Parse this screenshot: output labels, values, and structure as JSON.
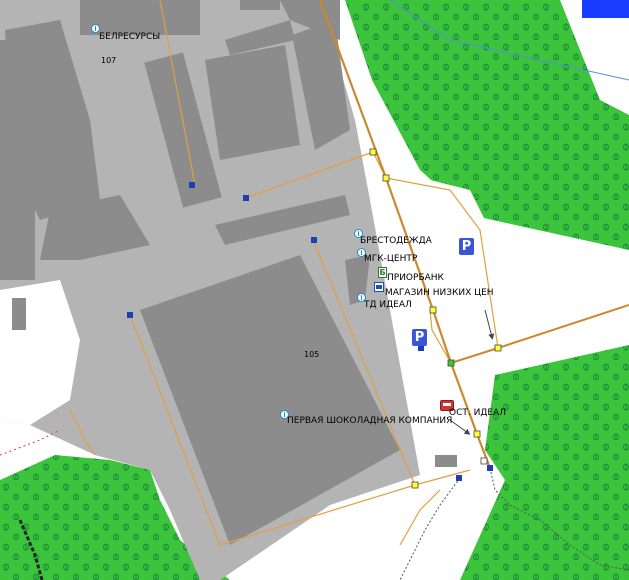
{
  "map": {
    "colors": {
      "background": "#ffffff",
      "forest": "#3cc43c",
      "tree_symbol": "#1c8c3a",
      "industrial_zone": "#b4b4b4",
      "building": "#8c8c8c",
      "road_line": "#e0a040",
      "main_road": "#c88a2c",
      "water": "#1a3cff",
      "node_yellow": "#ffff33",
      "node_blue": "#1d3fb5",
      "node_green": "#33cc33"
    },
    "blocks": [
      {
        "id": "block-107",
        "number": "107"
      },
      {
        "id": "block-105",
        "number": "105"
      }
    ],
    "pois": [
      {
        "id": "belresursy",
        "label": "БЕЛРЕСУРСЫ",
        "icon": "poi-circle-icon"
      },
      {
        "id": "brestodezhda",
        "label": "БРЕСТОДЕЖДА",
        "icon": "poi-circle-icon"
      },
      {
        "id": "mgk-centr",
        "label": "МГК-ЦЕНТР",
        "icon": "poi-circle-icon"
      },
      {
        "id": "priorbank",
        "label": "ПРИОРБАНК",
        "icon": "bank-icon"
      },
      {
        "id": "magazin",
        "label": "МАГАЗИН НИЗКИХ ЦЕН",
        "icon": "shop-icon"
      },
      {
        "id": "td-ideal",
        "label": "ТД ИДЕАЛ",
        "icon": "poi-circle-icon"
      },
      {
        "id": "ost-ideal",
        "label": "ОСТ. ИДЕАЛ",
        "icon": "bus-stop-icon"
      },
      {
        "id": "chocolate",
        "label": "ПЕРВАЯ ШОКОЛАДНАЯ КОМПАНИЯ",
        "icon": "poi-circle-icon"
      }
    ],
    "parking": [
      {
        "id": "parking-1",
        "label": "P"
      },
      {
        "id": "parking-2",
        "label": "P"
      }
    ],
    "bank_glyph": "Б"
  }
}
